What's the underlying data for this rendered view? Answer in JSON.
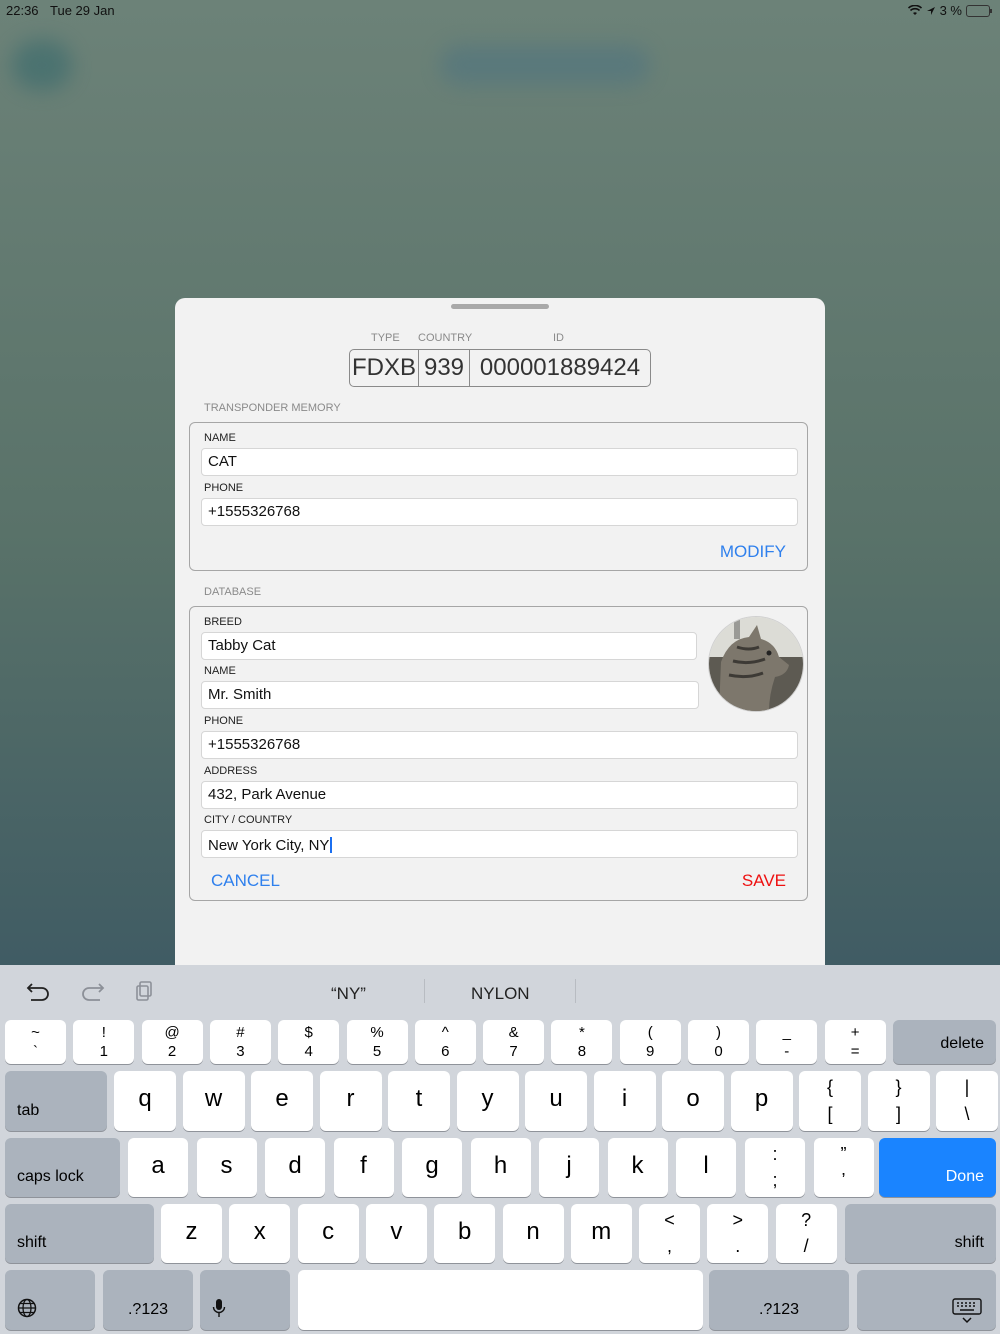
{
  "status": {
    "time": "22:36",
    "date": "Tue 29 Jan",
    "battery": "3 %"
  },
  "header": {
    "type_label": "TYPE",
    "country_label": "COUNTRY",
    "id_label": "ID",
    "type": "FDXB",
    "country": "939",
    "id": "000001889424"
  },
  "transponder": {
    "section_label": "TRANSPONDER MEMORY",
    "name_label": "NAME",
    "name": "CAT",
    "phone_label": "PHONE",
    "phone": "+1555326768",
    "modify": "MODIFY"
  },
  "database": {
    "section_label": "DATABASE",
    "breed_label": "BREED",
    "breed": "Tabby Cat",
    "name_label": "NAME",
    "name": "Mr. Smith",
    "phone_label": "PHONE",
    "phone": "+1555326768",
    "address_label": "ADDRESS",
    "address": "432, Park Avenue",
    "city_label": "CITY / COUNTRY",
    "city": "New York City, NY",
    "cancel": "CANCEL",
    "save": "SAVE"
  },
  "keyboard": {
    "suggestions": [
      "“NY”",
      "NYLON"
    ],
    "tools": [
      "undo-icon",
      "redo-icon",
      "paste-icon"
    ],
    "row1": [
      [
        "~",
        "`"
      ],
      [
        "!",
        "1"
      ],
      [
        "@",
        "2"
      ],
      [
        "#",
        "3"
      ],
      [
        "$",
        "4"
      ],
      [
        "%",
        "5"
      ],
      [
        "^",
        "6"
      ],
      [
        "&",
        "7"
      ],
      [
        "*",
        "8"
      ],
      [
        "(",
        "9"
      ],
      [
        ")",
        "0"
      ],
      [
        "_",
        "-"
      ],
      [
        "+",
        "="
      ]
    ],
    "delete": "delete",
    "tab": "tab",
    "row2": [
      "q",
      "w",
      "e",
      "r",
      "t",
      "y",
      "u",
      "i",
      "o",
      "p"
    ],
    "row2_sym": [
      [
        "{",
        "["
      ],
      [
        "}",
        "]"
      ],
      [
        "|",
        "\\"
      ]
    ],
    "caps": "caps lock",
    "row3": [
      "a",
      "s",
      "d",
      "f",
      "g",
      "h",
      "j",
      "k",
      "l"
    ],
    "row3_sym": [
      [
        ":",
        ";"
      ],
      [
        "”",
        "’"
      ]
    ],
    "done": "Done",
    "shift": "shift",
    "row4": [
      "z",
      "x",
      "c",
      "v",
      "b",
      "n",
      "m"
    ],
    "row4_sym": [
      [
        "<",
        ","
      ],
      [
        ">",
        "."
      ],
      [
        "?",
        "/"
      ]
    ],
    "num": ".?123",
    "colors": {
      "accent": "#2f80ed",
      "save": "#ee1111",
      "done": "#1a84ff"
    }
  }
}
